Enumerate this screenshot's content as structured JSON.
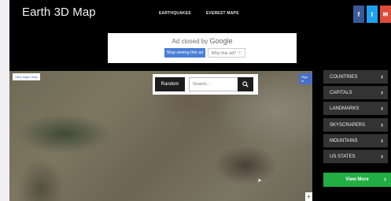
{
  "header": {
    "title": "Earth 3D Map",
    "nav": [
      "EARTHQUAKES",
      "EVEREST MAPS"
    ],
    "social": [
      {
        "label": "f",
        "icon": "facebook-icon",
        "color": "#3b5998"
      },
      {
        "label": "t",
        "icon": "twitter-icon",
        "color": "#1da1f2"
      },
      {
        "label": "✉",
        "icon": "mail-icon",
        "color": "#dd4b39"
      }
    ]
  },
  "ad": {
    "closed_text": "Ad closed by",
    "brand": "Google",
    "stop_label": "Stop seeing this ad",
    "why_label": "Why this ad? ⓘ"
  },
  "map": {
    "view_larger": "View larger map",
    "sign_in": "Sign in",
    "random_label": "Random",
    "search_placeholder": "Search...",
    "zoom_in": "+"
  },
  "sidebar": {
    "items": [
      {
        "label": "COUNTRIES"
      },
      {
        "label": "CAPITALS"
      },
      {
        "label": "LANDMARKS"
      },
      {
        "label": "SKYSCRAPERS"
      },
      {
        "label": "MOUNTAINS"
      },
      {
        "label": "US STATES"
      }
    ],
    "view_more": "View More"
  },
  "colors": {
    "accent_green": "#22ad45",
    "ad_button_blue": "#4a7fd3",
    "sidebar_bg": "#333333"
  }
}
